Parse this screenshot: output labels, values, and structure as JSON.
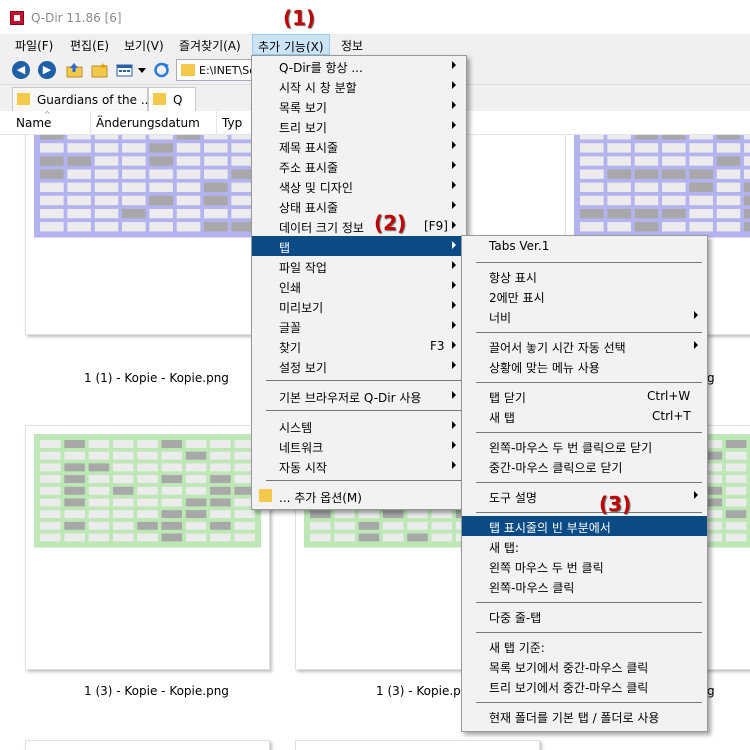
{
  "window": {
    "title": "Q-Dir 11.86 [6]"
  },
  "menubar": {
    "items": [
      {
        "label": "파일(F)"
      },
      {
        "label": "편집(E)"
      },
      {
        "label": "보기(V)"
      },
      {
        "label": "즐겨찾기(A)"
      },
      {
        "label": "추가 기능(X)"
      },
      {
        "label": "정보"
      }
    ]
  },
  "toolbar": {
    "address": "E:\\INET\\Sc"
  },
  "tabs": [
    {
      "label": "Guardians of the ..."
    },
    {
      "label": "Q"
    }
  ],
  "columns": [
    {
      "label": "Name"
    },
    {
      "label": "Änderungsdatum"
    },
    {
      "label": "Typ"
    }
  ],
  "files": {
    "row1": [
      "1 (1) - Kopie - Kopie.png",
      "g"
    ],
    "row2": [
      "1 (3) - Kopie - Kopie.png",
      "1 (3) - Kopie.png",
      "g"
    ]
  },
  "colors": {
    "thumb_blue_grid": "#b3b3ef",
    "thumb_green_grid": "#bde8b6",
    "thumb_gray_cell": "#a8a8a8",
    "thumb_light_cell": "#ececec",
    "menu_highlight": "#0a4b86",
    "badge": "#c00000"
  },
  "badges": [
    "(1)",
    "(2)",
    "(3)"
  ],
  "extras_menu": {
    "items": [
      {
        "label": "Q-Dir를 항상 ..."
      },
      {
        "label": "시작 시 창 분할"
      },
      {
        "label": "목록 보기"
      },
      {
        "label": "트리 보기"
      },
      {
        "label": "제목 표시줄"
      },
      {
        "label": "주소 표시줄"
      },
      {
        "label": "색상 및 디자인"
      },
      {
        "label": "상태 표시줄"
      },
      {
        "label": "데이터 크기 정보",
        "shortcut": "[F9]"
      },
      {
        "label": "탭"
      },
      {
        "label": "파일 작업"
      },
      {
        "label": "인쇄"
      },
      {
        "label": "미리보기"
      },
      {
        "label": "글꼴"
      },
      {
        "label": "찾기",
        "shortcut": "F3"
      },
      {
        "label": "설정 보기"
      },
      {
        "label": "기본 브라우저로 Q-Dir 사용"
      },
      {
        "label": "시스템"
      },
      {
        "label": "네트워크"
      },
      {
        "label": "자동 시작"
      },
      {
        "label": "... 추가 옵션(M)"
      }
    ]
  },
  "tabs_menu": {
    "items": [
      {
        "label": "Tabs Ver.1"
      },
      {
        "label": "항상 표시"
      },
      {
        "label": "2에만 표시"
      },
      {
        "label": "너비"
      },
      {
        "label": "끌어서 놓기 시간 자동 선택"
      },
      {
        "label": "상황에 맞는 메뉴 사용"
      },
      {
        "label": "탭 닫기",
        "shortcut": "Ctrl+W"
      },
      {
        "label": "새 탭",
        "shortcut": "Ctrl+T"
      },
      {
        "label": "왼쪽-마우스 두 번 클릭으로 닫기"
      },
      {
        "label": "중간-마우스 클릭으로 닫기"
      },
      {
        "label": "도구 설명"
      },
      {
        "label": "탭 표시줄의 빈 부분에서"
      },
      {
        "label": "새 탭:"
      },
      {
        "label": "왼쪽 마우스 두 번 클릭"
      },
      {
        "label": "왼쪽-마우스 클릭"
      },
      {
        "label": "다중 줄-탭"
      },
      {
        "label": "새 탭 기준:"
      },
      {
        "label": "목록 보기에서 중간-마우스 클릭"
      },
      {
        "label": "트리 보기에서 중간-마우스 클릭"
      },
      {
        "label": "현재 폴더를 기본 탭 / 폴더로 사용"
      }
    ]
  }
}
